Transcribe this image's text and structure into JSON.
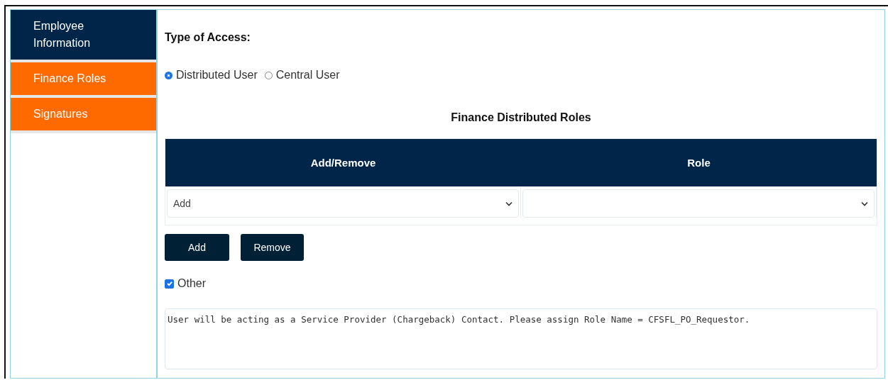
{
  "sidebar": {
    "items": [
      {
        "label": "Employee Information",
        "selected": true
      },
      {
        "label": "Finance Roles",
        "selected": false
      },
      {
        "label": "Signatures",
        "selected": false
      }
    ]
  },
  "access": {
    "label": "Type of Access:",
    "options": [
      {
        "label": "Distributed User",
        "selected": true
      },
      {
        "label": "Central User",
        "selected": false
      }
    ]
  },
  "roles_title": "Finance Distributed Roles",
  "table": {
    "columns": [
      "Add/Remove",
      "Role"
    ],
    "row": [
      {
        "value": "Add"
      }
    ]
  },
  "buttons": [
    "Add",
    "Remove"
  ],
  "other": {
    "label": "Other",
    "checked": true
  },
  "comment": {
    "value": "User will be acting as a Service Provider (Chargeback) Contact. Please assign Role Name = CFSFL_PO_Requestor."
  }
}
